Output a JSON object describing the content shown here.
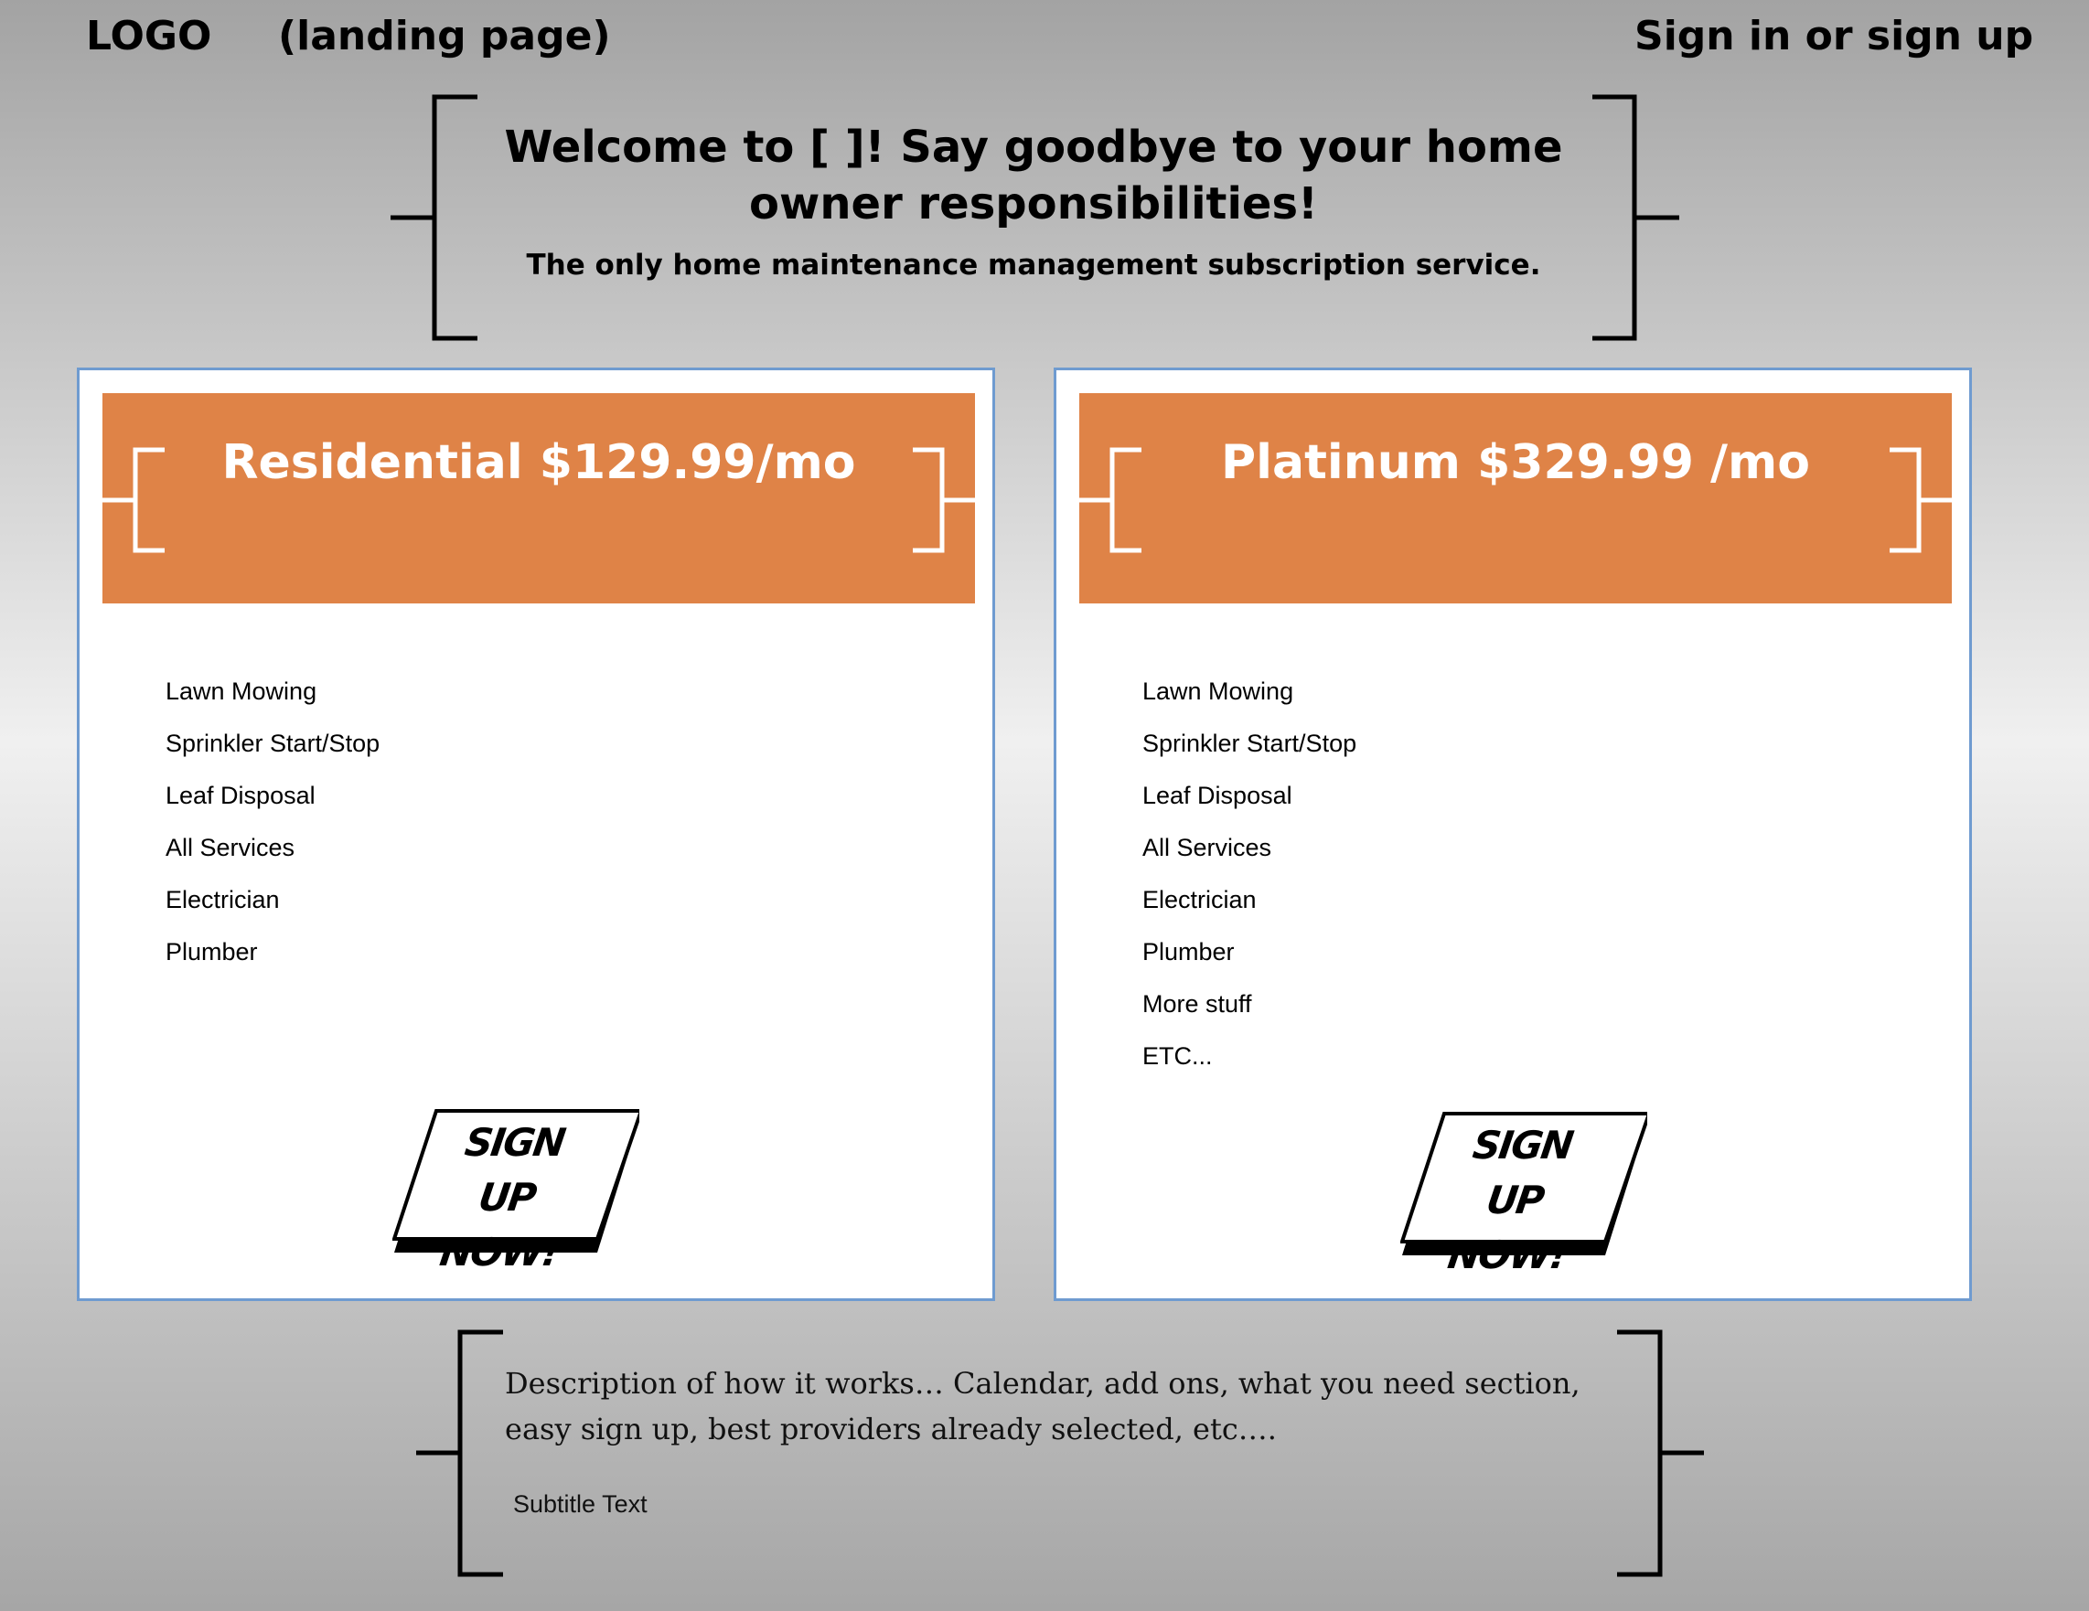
{
  "header": {
    "logo": "LOGO",
    "page_label": "(landing page)",
    "auth_link": "Sign in or sign up"
  },
  "hero": {
    "title": "Welcome to [  ]! Say goodbye to your home owner responsibilities!",
    "subtitle": "The only home maintenance management subscription service."
  },
  "plans": [
    {
      "title": "Residential $129.99/mo",
      "features": [
        "Lawn Mowing",
        "Sprinkler Start/Stop",
        "Leaf Disposal",
        "All Services",
        "Electrician",
        "Plumber"
      ],
      "cta_line1": "SIGN UP",
      "cta_line2": "NOW!"
    },
    {
      "title": "Platinum $329.99 /mo",
      "features": [
        "Lawn Mowing",
        "Sprinkler Start/Stop",
        "Leaf Disposal",
        "All Services",
        "Electrician",
        "Plumber",
        "More stuff",
        "ETC..."
      ],
      "cta_line1": "SIGN UP",
      "cta_line2": "NOW!"
    }
  ],
  "description": {
    "text": "Description of how it works… Calendar, add ons, what you need section, easy sign up, best providers already selected, etc….",
    "subtitle": "Subtitle Text"
  },
  "colors": {
    "header_orange": "#df8347",
    "card_border": "#6f9bd0"
  }
}
